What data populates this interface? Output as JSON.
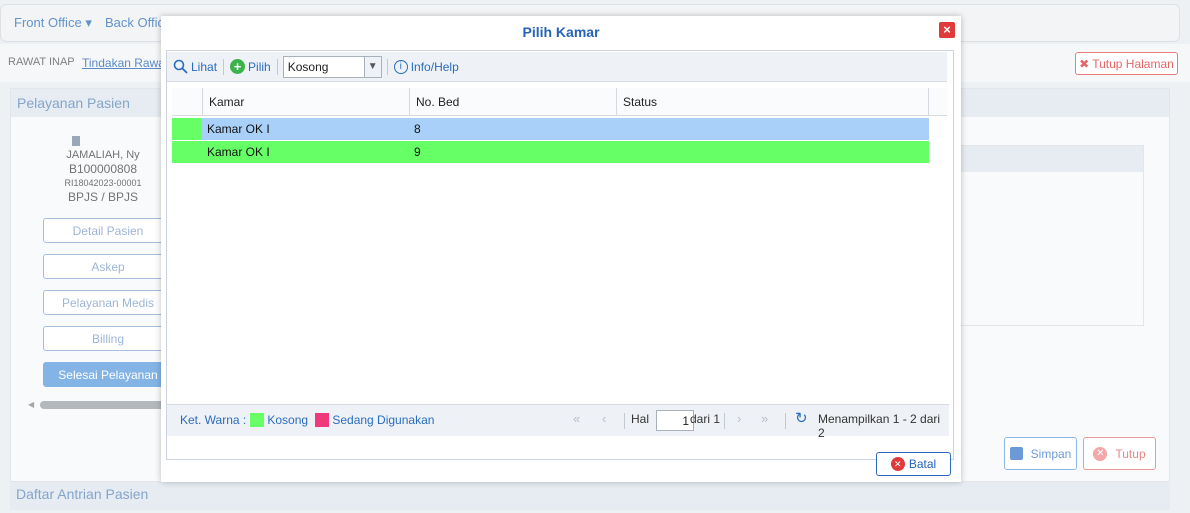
{
  "topbar": {
    "menus": [
      "Front Office",
      "Back Office"
    ]
  },
  "subbar": {
    "section": "RAWAT INAP",
    "active_tab": "Tindakan Rawat",
    "close_page_label": "Tutup Halaman"
  },
  "panel": {
    "title": "Pelayanan Pasien"
  },
  "patient": {
    "name": "JAMALIAH, Ny",
    "rm": "B100000808",
    "reg": "RI18042023-00001",
    "payer": "BPJS / BPJS"
  },
  "side_buttons": [
    "Detail Pasien",
    "Askep",
    "Pelayanan Medis",
    "Billing",
    "Selesai Pelayanan"
  ],
  "actions": {
    "save": "Simpan",
    "close": "Tutup"
  },
  "queue": {
    "title": "Daftar Antrian Pasien"
  },
  "modal": {
    "title": "Pilih Kamar",
    "close_icon": "×",
    "toolbar": {
      "view": "Lihat",
      "pick": "Pilih",
      "filter_value": "Kosong",
      "help": "Info/Help"
    },
    "columns": [
      "Kamar",
      "No. Bed",
      "Status"
    ],
    "rows": [
      {
        "kamar": "Kamar OK I",
        "bed": "8",
        "status": "",
        "selected": true
      },
      {
        "kamar": "Kamar OK I",
        "bed": "9",
        "status": "",
        "selected": false
      }
    ],
    "legend": {
      "label": "Ket. Warna :",
      "empty": "Kosong",
      "used": "Sedang Digunakan",
      "empty_color": "#66ff66",
      "used_color": "#f0397a"
    },
    "pager": {
      "page_label": "Hal",
      "page": "1",
      "of_label": "dari 1",
      "summary": "Menampilkan 1 - 2 dari 2"
    },
    "cancel_label": "Batal"
  },
  "colors": {
    "accent": "#2463b8",
    "selected_row": "#a9d0f8",
    "available": "#66ff66",
    "danger": "#e03a3a"
  }
}
